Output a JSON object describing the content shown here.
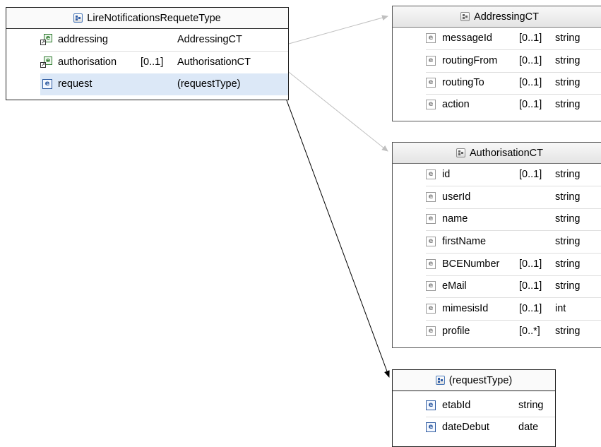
{
  "main_type": {
    "title": "LireNotificationsRequeteType",
    "rows": [
      {
        "name": "addressing",
        "occ": "",
        "type": "AddressingCT"
      },
      {
        "name": "authorisation",
        "occ": "[0..1]",
        "type": "AuthorisationCT"
      },
      {
        "name": "request",
        "occ": "",
        "type": "(requestType)"
      }
    ]
  },
  "addressing_ct": {
    "title": "AddressingCT",
    "rows": [
      {
        "name": "messageId",
        "occ": "[0..1]",
        "type": "string"
      },
      {
        "name": "routingFrom",
        "occ": "[0..1]",
        "type": "string"
      },
      {
        "name": "routingTo",
        "occ": "[0..1]",
        "type": "string"
      },
      {
        "name": "action",
        "occ": "[0..1]",
        "type": "string"
      }
    ]
  },
  "authorisation_ct": {
    "title": "AuthorisationCT",
    "rows": [
      {
        "name": "id",
        "occ": "[0..1]",
        "type": "string"
      },
      {
        "name": "userId",
        "occ": "",
        "type": "string"
      },
      {
        "name": "name",
        "occ": "",
        "type": "string"
      },
      {
        "name": "firstName",
        "occ": "",
        "type": "string"
      },
      {
        "name": "BCENumber",
        "occ": "[0..1]",
        "type": "string"
      },
      {
        "name": "eMail",
        "occ": "[0..1]",
        "type": "string"
      },
      {
        "name": "mimesisId",
        "occ": "[0..1]",
        "type": "int"
      },
      {
        "name": "profile",
        "occ": "[0..*]",
        "type": "string"
      }
    ]
  },
  "request_type": {
    "title": "(requestType)",
    "rows": [
      {
        "name": "etabId",
        "occ": "",
        "type": "string"
      },
      {
        "name": "dateDebut",
        "occ": "",
        "type": "date"
      }
    ]
  },
  "icons": {
    "complex_type": "complex-type-icon",
    "element": "element-icon",
    "element_ref": "element-reference-icon",
    "sequence": "sequence-compositor-icon"
  },
  "colors": {
    "selected_row": "#dce8f7",
    "element_icon_blue": "#2d5aa0",
    "connector_gray": "#c0c0c0",
    "connector_black": "#000000"
  }
}
